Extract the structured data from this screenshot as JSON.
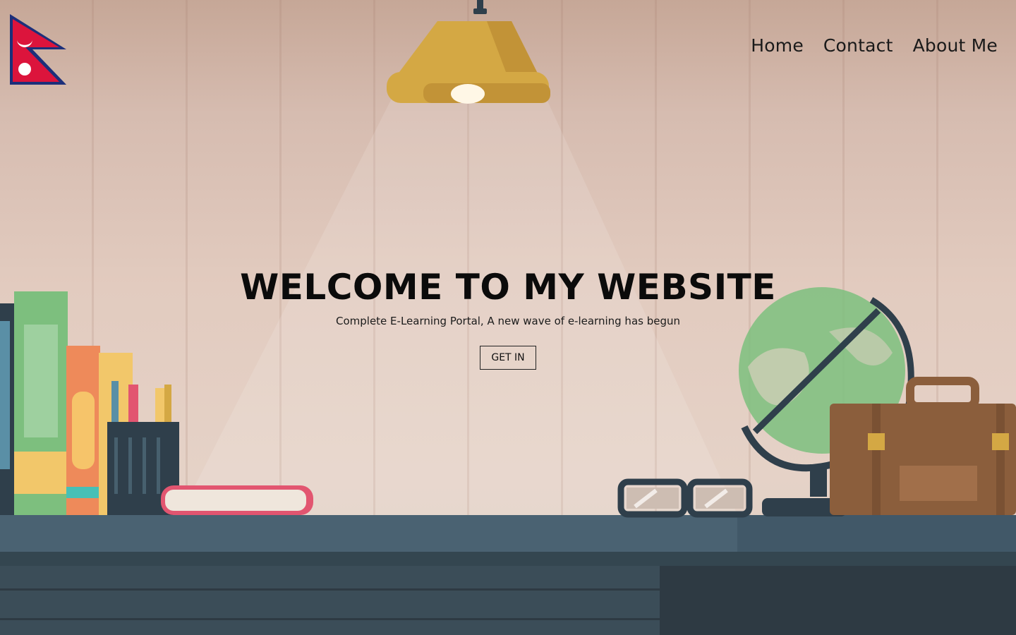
{
  "nav": {
    "items": [
      {
        "label": "Home"
      },
      {
        "label": "Contact"
      },
      {
        "label": "About Me"
      }
    ]
  },
  "hero": {
    "title": "WELCOME TO MY WEBSITE",
    "subtitle": "Complete E-Learning Portal, A new wave of e-learning has begun",
    "cta_label": "GET IN"
  },
  "colors": {
    "wall": "#e2cbbf",
    "desk": "#4a6272",
    "lamp": "#d4a844",
    "globe_land": "#7dbf7e",
    "briefcase": "#8b5e3c",
    "flag_red": "#dc143c",
    "flag_blue": "#003893"
  },
  "icons": [
    "nepal-flag-logo",
    "pendant-lamp",
    "books",
    "pencil-cup",
    "globe",
    "glasses",
    "briefcase"
  ]
}
